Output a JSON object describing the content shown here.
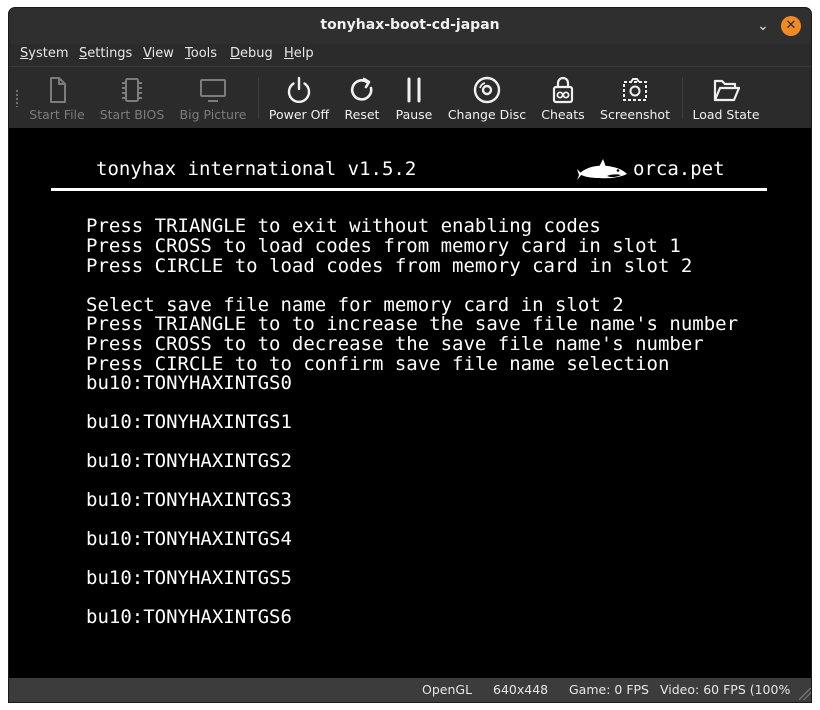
{
  "window": {
    "title": "tonyhax-boot-cd-japan"
  },
  "menu": [
    {
      "label": "System",
      "accel": "S",
      "rest": "ystem"
    },
    {
      "label": "Settings",
      "accel": "S",
      "rest": "ettings"
    },
    {
      "label": "View",
      "accel": "V",
      "rest": "iew"
    },
    {
      "label": "Tools",
      "accel": "T",
      "rest": "ools"
    },
    {
      "label": "Debug",
      "accel": "D",
      "rest": "ebug"
    },
    {
      "label": "Help",
      "accel": "H",
      "rest": "elp"
    }
  ],
  "toolbar": [
    {
      "label": "Start File",
      "icon": "file-icon",
      "enabled": false
    },
    {
      "label": "Start BIOS",
      "icon": "chip-icon",
      "enabled": false
    },
    {
      "label": "Big Picture",
      "icon": "monitor-icon",
      "enabled": false
    },
    {
      "label": "Power Off",
      "icon": "power-icon",
      "enabled": true
    },
    {
      "label": "Reset",
      "icon": "reset-icon",
      "enabled": true
    },
    {
      "label": "Pause",
      "icon": "pause-icon",
      "enabled": true
    },
    {
      "label": "Change Disc",
      "icon": "disc-icon",
      "enabled": true
    },
    {
      "label": "Cheats",
      "icon": "cheats-icon",
      "enabled": true
    },
    {
      "label": "Screenshot",
      "icon": "screenshot-icon",
      "enabled": true
    },
    {
      "label": "Load State",
      "icon": "folder-open-icon",
      "enabled": true
    }
  ],
  "game_screen": {
    "header_title": "tonyhax international v1.5.2",
    "header_site": "orca.pet",
    "instructions": [
      "Press TRIANGLE to exit without enabling codes",
      "Press CROSS to load codes from memory card in slot 1",
      "Press CIRCLE to load codes from memory card in slot 2"
    ],
    "save_prompts": [
      "Select save file name for memory card in slot 2",
      "Press TRIANGLE to to increase the save file name's number",
      "Press CROSS to to decrease the save file name's number",
      "Press CIRCLE to to confirm save file name selection"
    ],
    "save_files": [
      "bu10:TONYHAXINTGS0",
      "bu10:TONYHAXINTGS1",
      "bu10:TONYHAXINTGS2",
      "bu10:TONYHAXINTGS3",
      "bu10:TONYHAXINTGS4",
      "bu10:TONYHAXINTGS5",
      "bu10:TONYHAXINTGS6"
    ]
  },
  "status": {
    "renderer": "OpenGL",
    "resolution": "640x448",
    "game_fps": "Game: 0 FPS",
    "video_fps": "Video: 60 FPS (100%"
  },
  "colors": {
    "accent_close": "#f08a24",
    "chrome": "#2b2b2b",
    "screen": "#000000"
  }
}
